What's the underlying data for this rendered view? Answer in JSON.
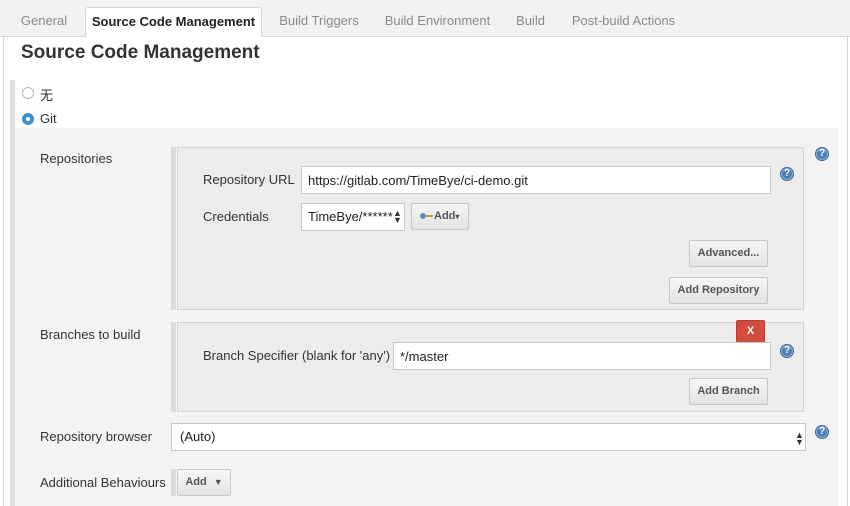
{
  "tabs": [
    {
      "label": "General",
      "active": false
    },
    {
      "label": "Source Code Management",
      "active": true
    },
    {
      "label": "Build Triggers",
      "active": false
    },
    {
      "label": "Build Environment",
      "active": false
    },
    {
      "label": "Build",
      "active": false
    },
    {
      "label": "Post-build Actions",
      "active": false
    }
  ],
  "section_title": "Source Code Management",
  "scm_options": [
    {
      "label": "无",
      "selected": false
    },
    {
      "label": "Git",
      "selected": true
    }
  ],
  "repositories": {
    "label": "Repositories",
    "url_label": "Repository URL",
    "url_value": "https://gitlab.com/TimeBye/ci-demo.git",
    "credentials_label": "Credentials",
    "credentials_value": "TimeBye/******",
    "add_label": "Add",
    "advanced_label": "Advanced...",
    "add_repository_label": "Add Repository"
  },
  "branches": {
    "label": "Branches to build",
    "delete_label": "X",
    "specifier_label": "Branch Specifier (blank for 'any')",
    "specifier_value": "*/master",
    "add_branch_label": "Add Branch"
  },
  "repository_browser": {
    "label": "Repository browser",
    "value": "(Auto)"
  },
  "additional_behaviours": {
    "label": "Additional Behaviours",
    "add_label": "Add"
  },
  "help_glyph": "?",
  "colors": {
    "accent": "#3d8fd6",
    "help": "#4f7fb4",
    "danger": "#d24c3f"
  }
}
